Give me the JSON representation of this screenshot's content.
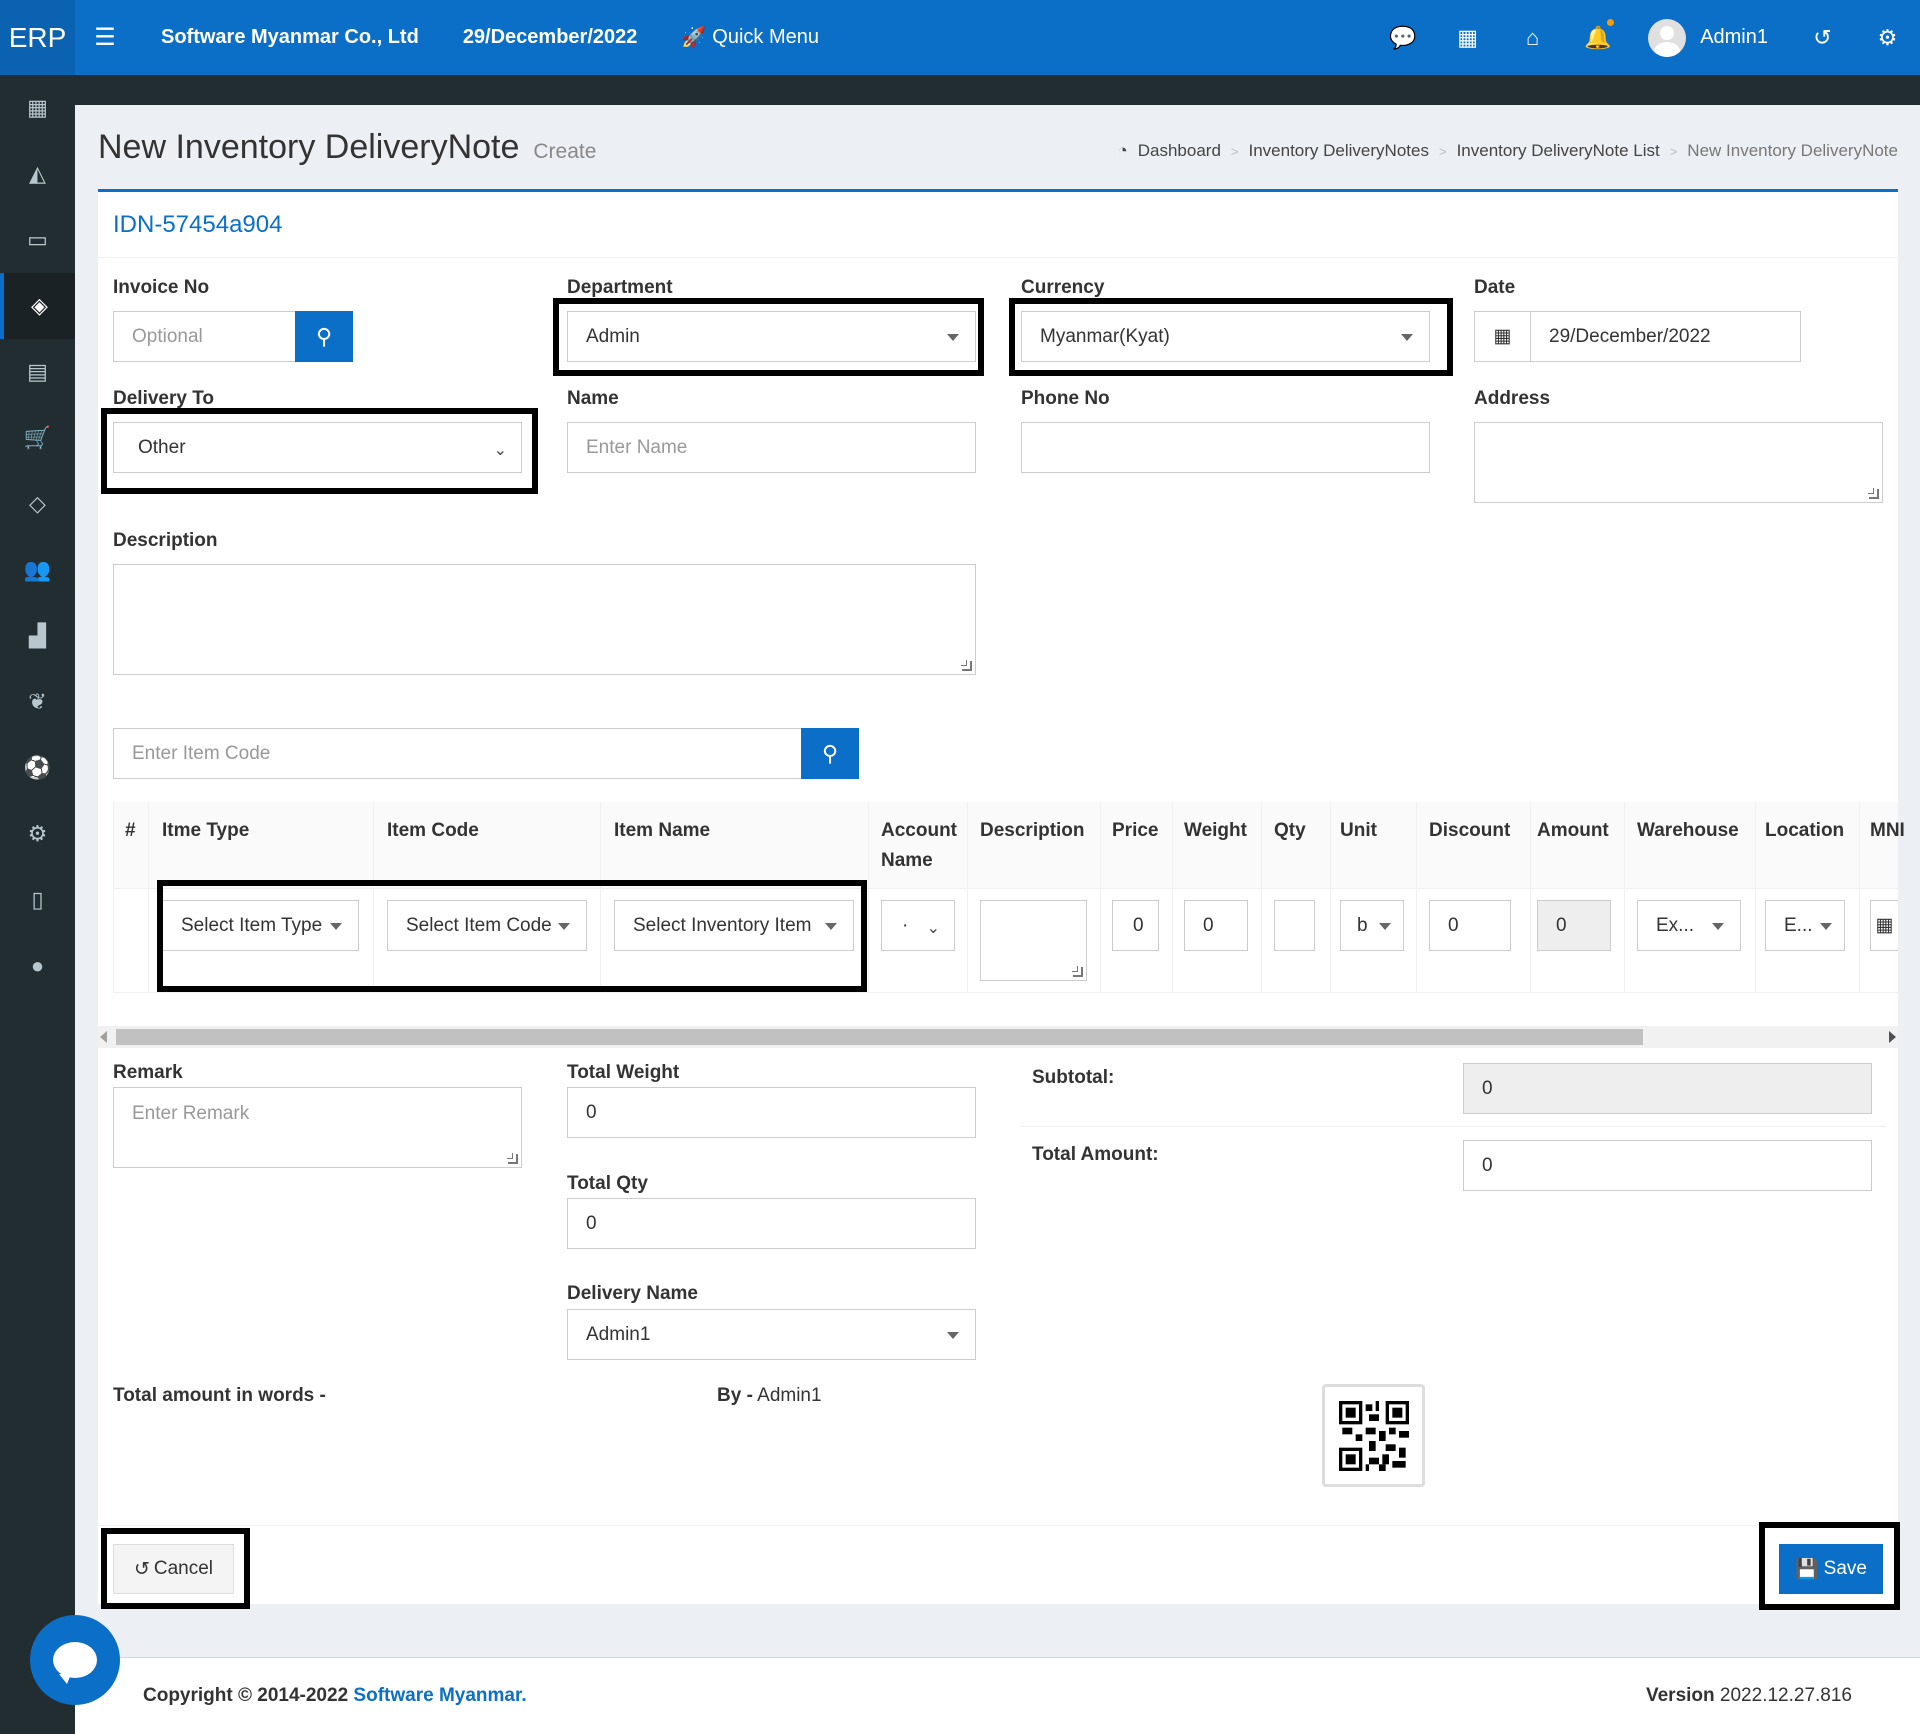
{
  "nav": {
    "logo": "ERP",
    "company": "Software Myanmar Co., Ltd",
    "date": "29/December/2022",
    "quick_menu": "Quick Menu",
    "user": "Admin1"
  },
  "page": {
    "title": "New Inventory DeliveryNote",
    "subtitle": "Create",
    "doc_id": "IDN-57454a904"
  },
  "breadcrumb": [
    "Dashboard",
    "Inventory DeliveryNotes",
    "Inventory DeliveryNote List",
    "New Inventory DeliveryNote"
  ],
  "form": {
    "invoice_label": "Invoice No",
    "invoice_placeholder": "Optional",
    "department_label": "Department",
    "department_value": "Admin",
    "currency_label": "Currency",
    "currency_value": "Myanmar(Kyat)",
    "date_label": "Date",
    "date_value": "29/December/2022",
    "delivery_to_label": "Delivery To",
    "delivery_to_value": "Other",
    "name_label": "Name",
    "name_placeholder": "Enter Name",
    "phone_label": "Phone No",
    "address_label": "Address",
    "description_label": "Description",
    "item_code_placeholder": "Enter Item Code"
  },
  "table": {
    "headers": [
      "#",
      "Itme Type",
      "Item Code",
      "Item Name",
      "Account Name",
      "Description",
      "Price",
      "Weight",
      "Qty",
      "Unit",
      "Discount",
      "Amount",
      "Warehouse",
      "Location",
      "MNI"
    ],
    "row": {
      "item_type": "Select Item Type",
      "item_code": "Select Item Code",
      "item_name": "Select Inventory Item",
      "account": "·",
      "price": "0",
      "weight": "0",
      "qty": "",
      "unit": "b",
      "discount": "0",
      "amount": "0",
      "warehouse": "Ex...",
      "location": "E..."
    }
  },
  "summary": {
    "remark_label": "Remark",
    "remark_placeholder": "Enter Remark",
    "total_weight_label": "Total Weight",
    "total_weight": "0",
    "total_qty_label": "Total Qty",
    "total_qty": "0",
    "delivery_name_label": "Delivery Name",
    "delivery_name": "Admin1",
    "subtotal_label": "Subtotal:",
    "subtotal": "0",
    "total_amount_label": "Total Amount:",
    "total_amount": "0",
    "words_label": "Total amount in words -",
    "by_label": "By -",
    "by_value": "Admin1"
  },
  "actions": {
    "cancel": "Cancel",
    "save": "Save"
  },
  "footer": {
    "copyright": "Copyright © 2014-2022",
    "brand": "Software Myanmar.",
    "version_label": "Version",
    "version": "2022.12.27.816"
  },
  "colors": {
    "primary": "#0b6fc7",
    "sidebar": "#222d32",
    "highlight": "#000000"
  }
}
